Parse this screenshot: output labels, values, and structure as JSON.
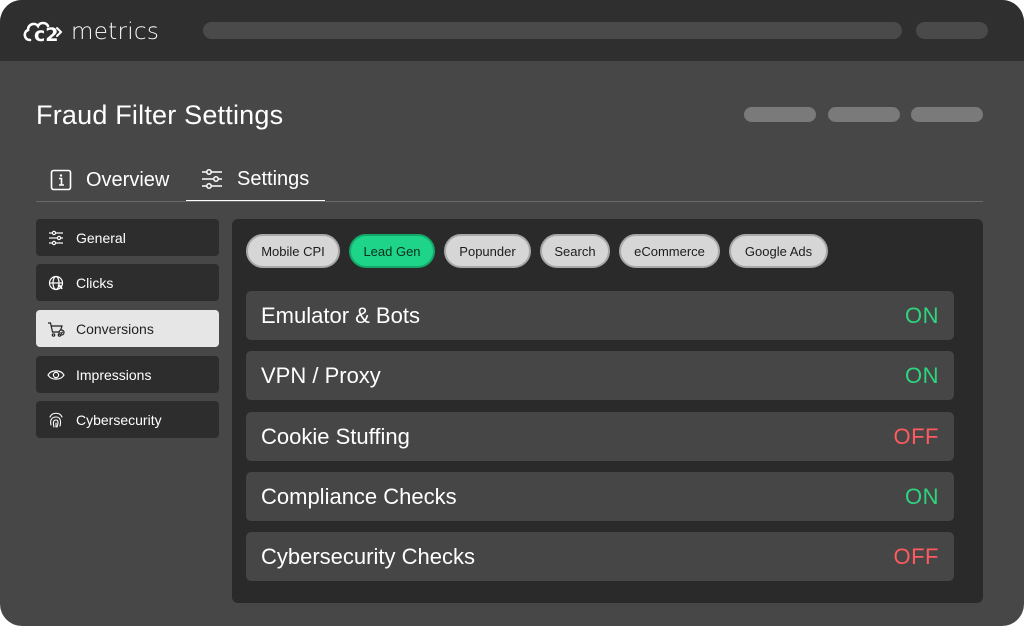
{
  "app": {
    "logo_prefix": "c2",
    "logo_name": "metrics"
  },
  "page": {
    "title": "Fraud Filter Settings"
  },
  "tabs": [
    {
      "label": "Overview",
      "icon": "info-icon",
      "active": false
    },
    {
      "label": "Settings",
      "icon": "sliders-icon",
      "active": true
    }
  ],
  "sidebar": {
    "items": [
      {
        "label": "General",
        "icon": "sliders-icon",
        "active": false
      },
      {
        "label": "Clicks",
        "icon": "globe-icon",
        "active": false
      },
      {
        "label": "Conversions",
        "icon": "cart-icon",
        "active": true
      },
      {
        "label": "Impressions",
        "icon": "eye-icon",
        "active": false
      },
      {
        "label": "Cybersecurity",
        "icon": "fingerprint-icon",
        "active": false
      }
    ]
  },
  "chips": [
    {
      "label": "Mobile CPI",
      "active": false
    },
    {
      "label": "Lead Gen",
      "active": true
    },
    {
      "label": "Popunder",
      "active": false
    },
    {
      "label": "Search",
      "active": false
    },
    {
      "label": "eCommerce",
      "active": false
    },
    {
      "label": "Google Ads",
      "active": false
    }
  ],
  "filters": [
    {
      "label": "Emulator & Bots",
      "status": "ON"
    },
    {
      "label": "VPN / Proxy",
      "status": "ON"
    },
    {
      "label": "Cookie Stuffing",
      "status": "OFF"
    },
    {
      "label": "Compliance Checks",
      "status": "ON"
    },
    {
      "label": "Cybersecurity Checks",
      "status": "OFF"
    }
  ],
  "colors": {
    "on": "#2ed47e",
    "off": "#ff5a5f",
    "accent": "#1ed488"
  }
}
